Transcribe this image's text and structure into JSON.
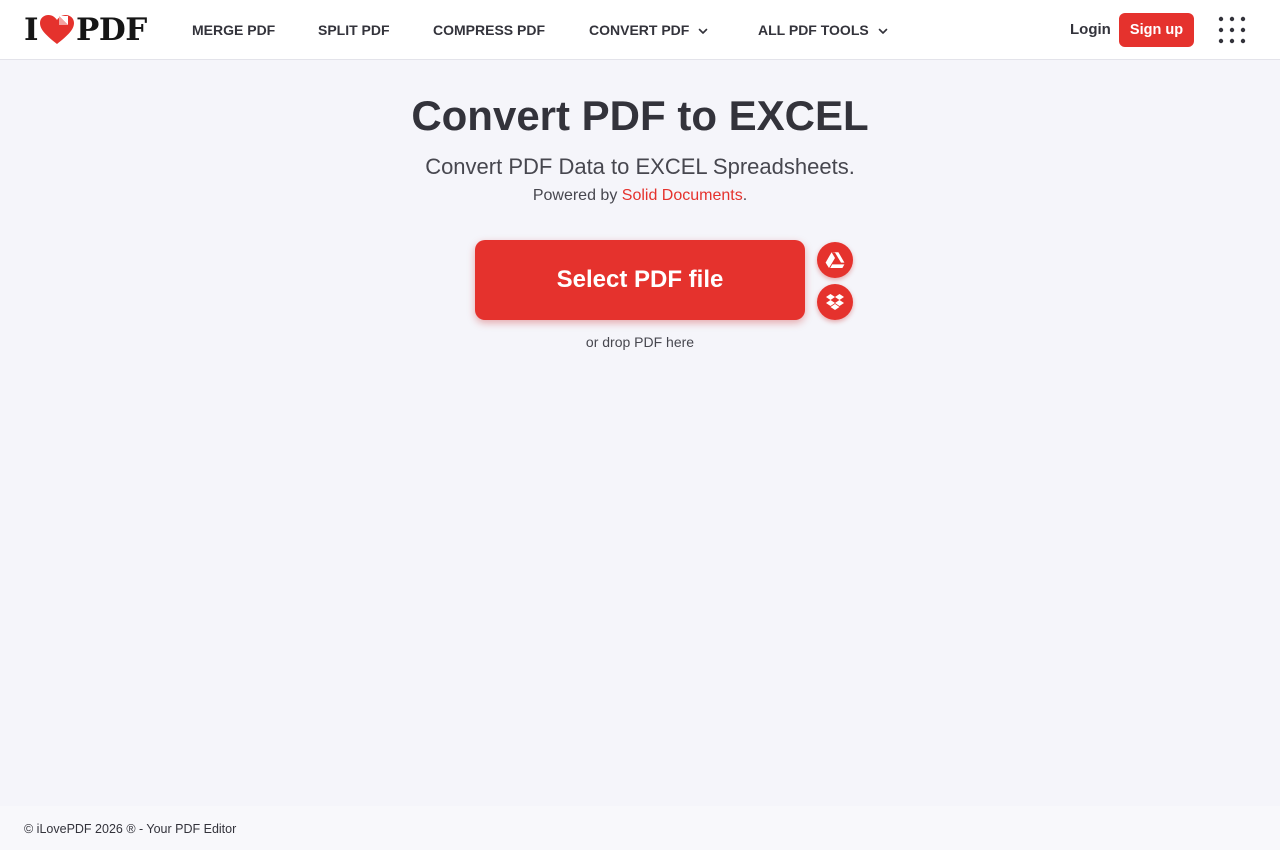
{
  "brand": {
    "logo_left": "I",
    "logo_right": "PDF",
    "heart_color": "#e5322d"
  },
  "nav": {
    "items": [
      {
        "label": "MERGE PDF",
        "dropdown": false
      },
      {
        "label": "SPLIT PDF",
        "dropdown": false
      },
      {
        "label": "COMPRESS PDF",
        "dropdown": false
      },
      {
        "label": "CONVERT PDF",
        "dropdown": true
      },
      {
        "label": "ALL PDF TOOLS",
        "dropdown": true
      }
    ],
    "login_label": "Login",
    "signup_label": "Sign up",
    "apps_icon": "grid-icon"
  },
  "main": {
    "title": "Convert PDF to EXCEL",
    "subtitle": "Convert PDF Data to EXCEL Spreadsheets.",
    "powered_prefix": "Powered by ",
    "powered_link": "Solid Documents",
    "powered_suffix": ".",
    "select_button": "Select PDF file",
    "drop_hint": "or drop PDF here",
    "cloud_sources": [
      {
        "icon": "google-drive-icon"
      },
      {
        "icon": "dropbox-icon"
      }
    ]
  },
  "footer": {
    "text": "© iLovePDF 2026 ® - Your PDF Editor"
  },
  "colors": {
    "accent": "#e5322d",
    "background": "#f5f5fa",
    "text": "#33333b"
  }
}
